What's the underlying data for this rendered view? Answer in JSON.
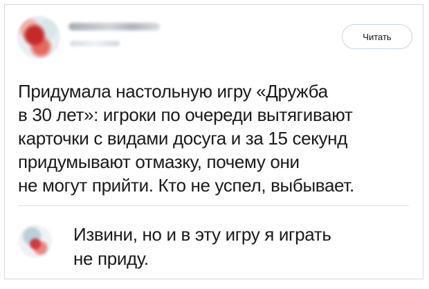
{
  "header": {
    "follow_label": "Читать"
  },
  "post": {
    "text_lines": [
      "Придумала настольную игру «Дружба",
      "в 30 лет»: игроки по очереди вытягивают",
      "карточки с видами досуга и за 15 секунд",
      "придумывают отмазку, почему они",
      "не могут прийти. Кто не успел, выбывает."
    ]
  },
  "comment": {
    "text_lines": [
      "Извини, но и в эту игру я играть",
      "не приду."
    ]
  },
  "icons": {
    "author_avatar": "blurred-avatar-icon",
    "commenter_avatar": "blurred-avatar-icon"
  },
  "colors": {
    "border": "#d9d9d9",
    "button_border": "#c8d5e2",
    "text": "#1a1a1a"
  }
}
